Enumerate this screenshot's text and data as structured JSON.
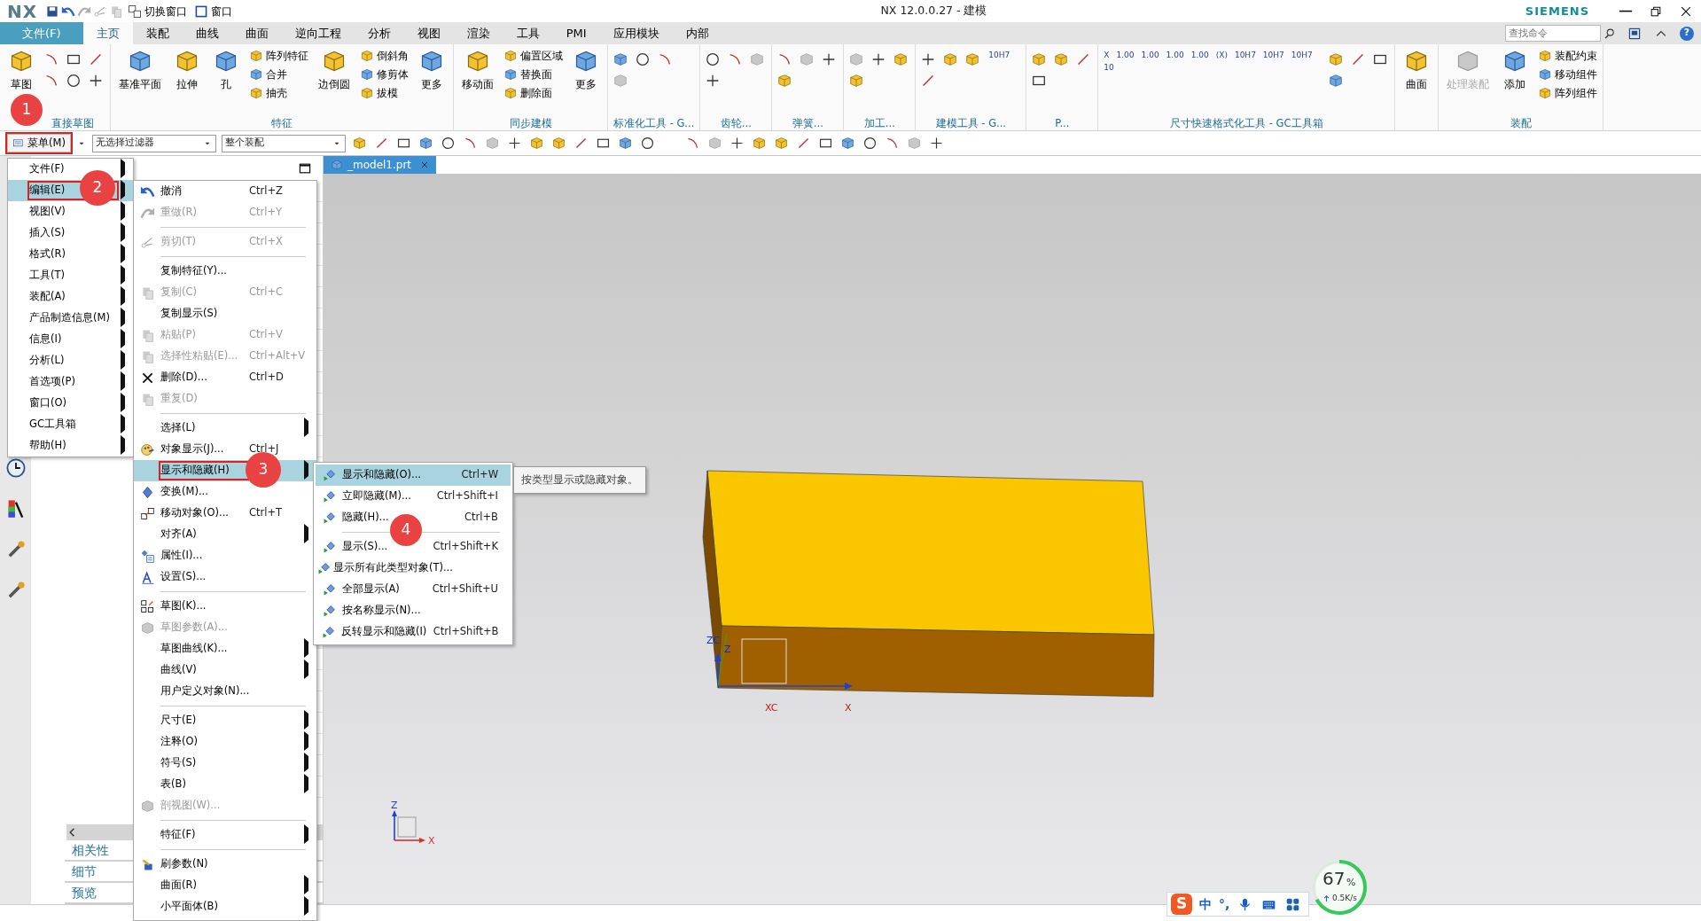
{
  "title_bar": {
    "logo": "NX",
    "quick_access": [
      "切换窗口",
      "窗口"
    ],
    "title": "NX 12.0.0.27 - 建模",
    "brand": "SIEMENS"
  },
  "ribbon_tabs": [
    {
      "label": "文件(F)",
      "kind": "file",
      "selected": false
    },
    {
      "label": "主页",
      "kind": "tab",
      "selected": true
    },
    {
      "label": "装配",
      "kind": "tab",
      "selected": false
    },
    {
      "label": "曲线",
      "kind": "tab",
      "selected": false
    },
    {
      "label": "曲面",
      "kind": "tab",
      "selected": false
    },
    {
      "label": "逆向工程",
      "kind": "tab",
      "selected": false
    },
    {
      "label": "分析",
      "kind": "tab",
      "selected": false
    },
    {
      "label": "视图",
      "kind": "tab",
      "selected": false
    },
    {
      "label": "渲染",
      "kind": "tab",
      "selected": false
    },
    {
      "label": "工具",
      "kind": "tab",
      "selected": false
    },
    {
      "label": "PMI",
      "kind": "tab",
      "selected": false
    },
    {
      "label": "应用模块",
      "kind": "tab",
      "selected": false
    },
    {
      "label": "内部",
      "kind": "tab",
      "selected": false
    }
  ],
  "search": {
    "placeholder": "查找命令"
  },
  "help_glyph": "?",
  "ribbon_groups": [
    {
      "label": "直接草图",
      "items": [
        {
          "kind": "large",
          "label": "草图",
          "disabled": false
        },
        {
          "kind": "tools"
        }
      ]
    },
    {
      "label": "特征",
      "items": [
        {
          "kind": "large",
          "label": "基准平面",
          "disabled": false
        },
        {
          "kind": "large",
          "label": "拉伸",
          "disabled": false
        },
        {
          "kind": "large",
          "label": "孔",
          "disabled": false
        },
        {
          "kind": "small",
          "labels": [
            "阵列特征",
            "合并",
            "抽壳"
          ]
        },
        {
          "kind": "large",
          "label": "边倒圆",
          "disabled": false
        },
        {
          "kind": "small",
          "labels": [
            "倒斜角",
            "修剪体",
            "拔模"
          ]
        },
        {
          "kind": "large",
          "label": "更多",
          "disabled": false
        }
      ]
    },
    {
      "label": "同步建模",
      "items": [
        {
          "kind": "large",
          "label": "移动面",
          "disabled": false
        },
        {
          "kind": "small",
          "labels": [
            "偏置区域",
            "替换面",
            "删除面"
          ]
        },
        {
          "kind": "large",
          "label": "更多",
          "disabled": false
        }
      ]
    },
    {
      "label": "标准化工具 - G...",
      "items": [
        {
          "kind": "tools"
        }
      ]
    },
    {
      "label": "齿轮...",
      "items": [
        {
          "kind": "tools"
        }
      ]
    },
    {
      "label": "弹簧...",
      "items": [
        {
          "kind": "tools"
        }
      ]
    },
    {
      "label": "加工...",
      "items": [
        {
          "kind": "tools"
        }
      ]
    },
    {
      "label": "建模工具 - G...",
      "items": [
        {
          "kind": "tools"
        },
        {
          "kind": "text_tools",
          "labels": [
            "10H7"
          ]
        }
      ]
    },
    {
      "label": "P...",
      "items": [
        {
          "kind": "tools"
        }
      ]
    },
    {
      "label": "尺寸快速格式化工具 - GC工具箱",
      "items": [
        {
          "kind": "text_tools",
          "labels": [
            "X",
            "1.00",
            "1.00",
            "1.00",
            "1.00",
            "(X)",
            "10H7",
            "10H7",
            "10H7",
            "10"
          ]
        },
        {
          "kind": "tools"
        }
      ]
    },
    {
      "items": [
        {
          "kind": "large",
          "label": "曲面",
          "disabled": false
        }
      ]
    },
    {
      "label": "装配",
      "items": [
        {
          "kind": "large",
          "label": "处理装配",
          "disabled": true
        },
        {
          "kind": "large",
          "label": "添加",
          "disabled": false
        },
        {
          "kind": "small",
          "labels": [
            "装配约束",
            "移动组件",
            "阵列组件"
          ]
        }
      ]
    }
  ],
  "toolbar": {
    "menu_button": {
      "label": "菜单(M)",
      "highlighted": true
    },
    "filters": [
      "无选择过滤器",
      "整个装配"
    ]
  },
  "document_tab": {
    "label": "_model1.prt"
  },
  "navigator_sections": [
    "相关性",
    "细节",
    "预览"
  ],
  "main_menu": [
    {
      "label": "文件(F)",
      "selected": false,
      "highlighted": false
    },
    {
      "label": "编辑(E)",
      "selected": true,
      "highlighted": true
    },
    {
      "label": "视图(V)",
      "selected": false,
      "highlighted": false
    },
    {
      "label": "插入(S)",
      "selected": false,
      "highlighted": false
    },
    {
      "label": "格式(R)",
      "selected": false,
      "highlighted": false
    },
    {
      "label": "工具(T)",
      "selected": false,
      "highlighted": false
    },
    {
      "label": "装配(A)",
      "selected": false,
      "highlighted": false
    },
    {
      "label": "产品制造信息(M)",
      "selected": false,
      "highlighted": false
    },
    {
      "label": "信息(I)",
      "selected": false,
      "highlighted": false
    },
    {
      "label": "分析(L)",
      "selected": false,
      "highlighted": false
    },
    {
      "label": "首选项(P)",
      "selected": false,
      "highlighted": false
    },
    {
      "label": "窗口(O)",
      "selected": false,
      "highlighted": false
    },
    {
      "label": "GC工具箱",
      "selected": false,
      "highlighted": false
    },
    {
      "label": "帮助(H)",
      "selected": false,
      "highlighted": false
    }
  ],
  "edit_menu": [
    {
      "kind": "item",
      "label": "撤消",
      "shortcut": "Ctrl+Z",
      "disabled": false,
      "submenu": false,
      "selected": false,
      "highlighted": false
    },
    {
      "kind": "item",
      "label": "重做(R)",
      "shortcut": "Ctrl+Y",
      "disabled": true,
      "submenu": false,
      "selected": false,
      "highlighted": false
    },
    {
      "kind": "separator"
    },
    {
      "kind": "item",
      "label": "剪切(T)",
      "shortcut": "Ctrl+X",
      "disabled": true,
      "submenu": false,
      "selected": false,
      "highlighted": false
    },
    {
      "kind": "separator"
    },
    {
      "kind": "item",
      "label": "复制特征(Y)...",
      "disabled": false,
      "submenu": false,
      "selected": false,
      "highlighted": false
    },
    {
      "kind": "item",
      "label": "复制(C)",
      "shortcut": "Ctrl+C",
      "disabled": true,
      "submenu": false,
      "selected": false,
      "highlighted": false
    },
    {
      "kind": "item",
      "label": "复制显示(S)",
      "disabled": false,
      "submenu": false,
      "selected": false,
      "highlighted": false
    },
    {
      "kind": "item",
      "label": "粘贴(P)",
      "shortcut": "Ctrl+V",
      "disabled": true,
      "submenu": false,
      "selected": false,
      "highlighted": false
    },
    {
      "kind": "item",
      "label": "选择性粘贴(E)...",
      "shortcut": "Ctrl+Alt+V",
      "disabled": true,
      "submenu": false,
      "selected": false,
      "highlighted": false
    },
    {
      "kind": "item",
      "label": "删除(D)...",
      "shortcut": "Ctrl+D",
      "disabled": false,
      "submenu": false,
      "selected": false,
      "highlighted": false
    },
    {
      "kind": "item",
      "label": "重复(D)",
      "disabled": true,
      "submenu": false,
      "selected": false,
      "highlighted": false
    },
    {
      "kind": "separator"
    },
    {
      "kind": "item",
      "label": "选择(L)",
      "disabled": false,
      "submenu": true,
      "selected": false,
      "highlighted": false
    },
    {
      "kind": "item",
      "label": "对象显示(J)...",
      "shortcut": "Ctrl+J",
      "disabled": false,
      "submenu": false,
      "selected": false,
      "highlighted": false
    },
    {
      "kind": "item",
      "label": "显示和隐藏(H)",
      "disabled": false,
      "submenu": true,
      "selected": true,
      "highlighted": true
    },
    {
      "kind": "item",
      "label": "变换(M)...",
      "disabled": false,
      "submenu": false,
      "selected": false,
      "highlighted": false
    },
    {
      "kind": "item",
      "label": "移动对象(O)...",
      "shortcut": "Ctrl+T",
      "disabled": false,
      "submenu": false,
      "selected": false,
      "highlighted": false
    },
    {
      "kind": "item",
      "label": "对齐(A)",
      "disabled": false,
      "submenu": true,
      "selected": false,
      "highlighted": false
    },
    {
      "kind": "item",
      "label": "属性(I)...",
      "disabled": false,
      "submenu": false,
      "selected": false,
      "highlighted": false
    },
    {
      "kind": "item",
      "label": "设置(S)...",
      "disabled": false,
      "submenu": false,
      "selected": false,
      "highlighted": false
    },
    {
      "kind": "separator"
    },
    {
      "kind": "item",
      "label": "草图(K)...",
      "disabled": false,
      "submenu": false,
      "selected": false,
      "highlighted": false
    },
    {
      "kind": "item",
      "label": "草图参数(A)...",
      "disabled": true,
      "submenu": false,
      "selected": false,
      "highlighted": false
    },
    {
      "kind": "item",
      "label": "草图曲线(K)...",
      "disabled": false,
      "submenu": true,
      "selected": false,
      "highlighted": false
    },
    {
      "kind": "item",
      "label": "曲线(V)",
      "disabled": false,
      "submenu": true,
      "selected": false,
      "highlighted": false
    },
    {
      "kind": "item",
      "label": "用户定义对象(N)...",
      "disabled": false,
      "submenu": false,
      "selected": false,
      "highlighted": false
    },
    {
      "kind": "separator"
    },
    {
      "kind": "item",
      "label": "尺寸(E)",
      "disabled": false,
      "submenu": true,
      "selected": false,
      "highlighted": false
    },
    {
      "kind": "item",
      "label": "注释(O)",
      "disabled": false,
      "submenu": true,
      "selected": false,
      "highlighted": false
    },
    {
      "kind": "item",
      "label": "符号(S)",
      "disabled": false,
      "submenu": true,
      "selected": false,
      "highlighted": false
    },
    {
      "kind": "item",
      "label": "表(B)",
      "disabled": false,
      "submenu": true,
      "selected": false,
      "highlighted": false
    },
    {
      "kind": "item",
      "label": "剖视图(W)...",
      "disabled": true,
      "submenu": false,
      "selected": false,
      "highlighted": false
    },
    {
      "kind": "separator"
    },
    {
      "kind": "item",
      "label": "特征(F)",
      "disabled": false,
      "submenu": true,
      "selected": false,
      "highlighted": false
    },
    {
      "kind": "separator"
    },
    {
      "kind": "item",
      "label": "刷参数(N)",
      "disabled": false,
      "submenu": false,
      "selected": false,
      "highlighted": false
    },
    {
      "kind": "item",
      "label": "曲面(R)",
      "disabled": false,
      "submenu": true,
      "selected": false,
      "highlighted": false
    },
    {
      "kind": "item",
      "label": "小平面体(B)",
      "disabled": false,
      "submenu": true,
      "selected": false,
      "highlighted": false
    }
  ],
  "show_hide_menu": [
    {
      "kind": "item",
      "label": "显示和隐藏(O)...",
      "shortcut": "Ctrl+W",
      "selected": true
    },
    {
      "kind": "item",
      "label": "立即隐藏(M)...",
      "shortcut": "Ctrl+Shift+I",
      "selected": false
    },
    {
      "kind": "item",
      "label": "隐藏(H)...",
      "shortcut": "Ctrl+B",
      "selected": false
    },
    {
      "kind": "separator"
    },
    {
      "kind": "item",
      "label": "显示(S)...",
      "shortcut": "Ctrl+Shift+K",
      "selected": false
    },
    {
      "kind": "item",
      "label": "显示所有此类型对象(T)...",
      "selected": false
    },
    {
      "kind": "item",
      "label": "全部显示(A)",
      "shortcut": "Ctrl+Shift+U",
      "selected": false
    },
    {
      "kind": "item",
      "label": "按名称显示(N)...",
      "selected": false
    },
    {
      "kind": "item",
      "label": "反转显示和隐藏(I)",
      "shortcut": "Ctrl+Shift+B",
      "selected": false
    }
  ],
  "tooltip": "按类型显示或隐藏对象。",
  "viewport": {
    "axis_labels": [
      "Z",
      "ZC",
      "X",
      "XC"
    ],
    "mini_triad_labels": [
      "Z",
      "X"
    ]
  },
  "step_badges": [
    "1",
    "2",
    "3",
    "4"
  ],
  "ime_bar": {
    "logo": "S",
    "items": [
      "中",
      "°,"
    ]
  },
  "network_meter": {
    "value": "67",
    "unit": "%",
    "speed": "0.5K/s",
    "level": 0.67
  }
}
